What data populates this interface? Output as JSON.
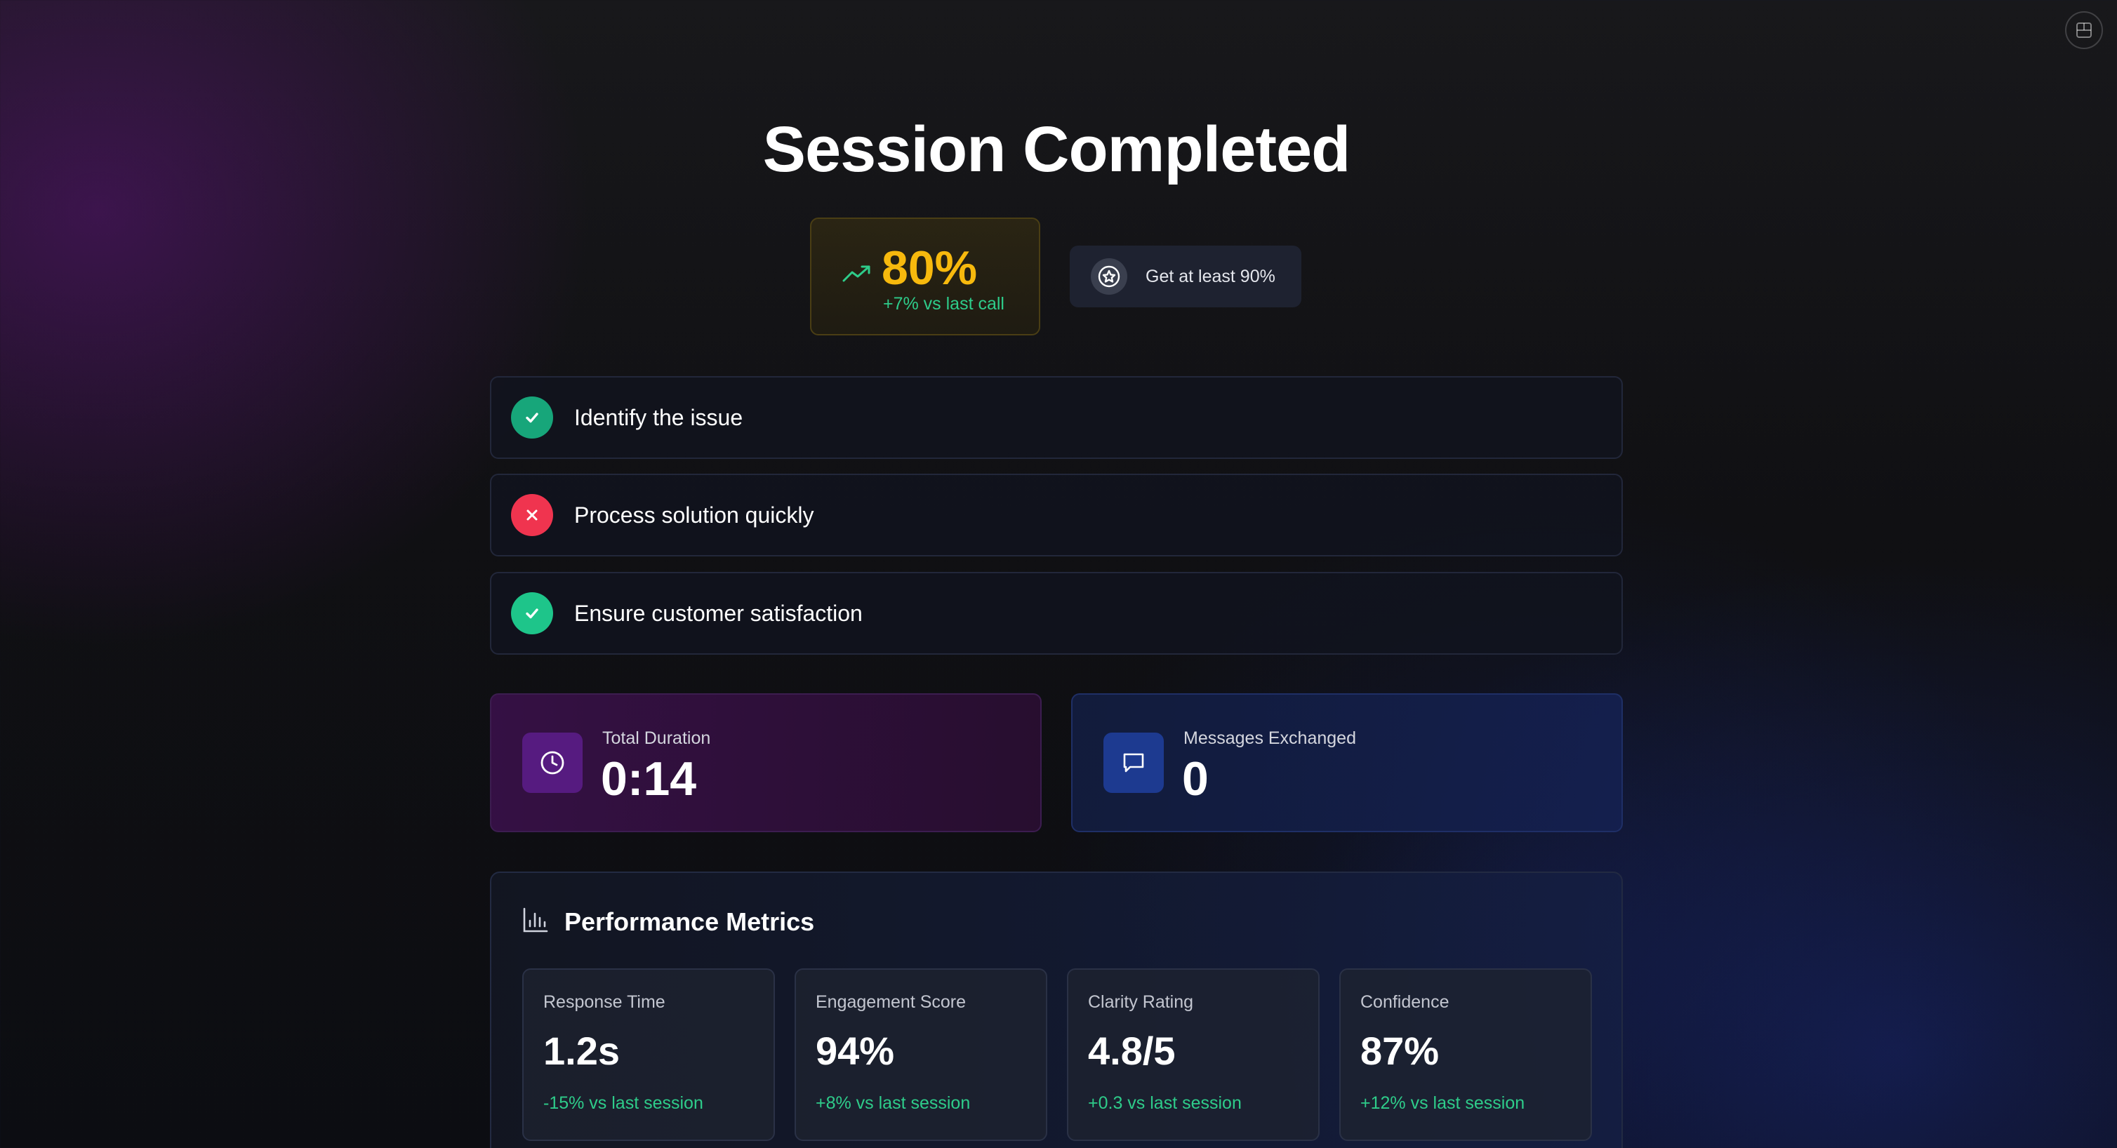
{
  "header": {
    "title": "Session Completed",
    "corner_icon": "panel-toggle-icon"
  },
  "score": {
    "value": "80%",
    "delta": "+7% vs last call",
    "icon": "trending-up-icon",
    "color": "#f7b90d"
  },
  "goal": {
    "text": "Get at least 90%",
    "icon": "star-badge-icon"
  },
  "objectives": [
    {
      "label": "Identify the issue",
      "status": "passed"
    },
    {
      "label": "Process solution quickly",
      "status": "failed"
    },
    {
      "label": "Ensure customer satisfaction",
      "status": "passed"
    }
  ],
  "stats": {
    "duration": {
      "label": "Total Duration",
      "value": "0:14",
      "icon": "clock-icon"
    },
    "messages": {
      "label": "Messages Exchanged",
      "value": "0",
      "icon": "chat-bubble-icon"
    }
  },
  "performance": {
    "title": "Performance Metrics",
    "icon": "bar-chart-icon",
    "metrics": [
      {
        "label": "Response Time",
        "value": "1.2s",
        "delta": "-15% vs last session"
      },
      {
        "label": "Engagement Score",
        "value": "94%",
        "delta": "+8% vs last session"
      },
      {
        "label": "Clarity Rating",
        "value": "4.8/5",
        "delta": "+0.3 vs last session"
      },
      {
        "label": "Confidence",
        "value": "87%",
        "delta": "+12% vs last session"
      }
    ]
  },
  "colors": {
    "success": "#1ec58a",
    "failure": "#f0344f",
    "accent_gold": "#f7b90d",
    "delta_green": "#2ecc8a"
  }
}
